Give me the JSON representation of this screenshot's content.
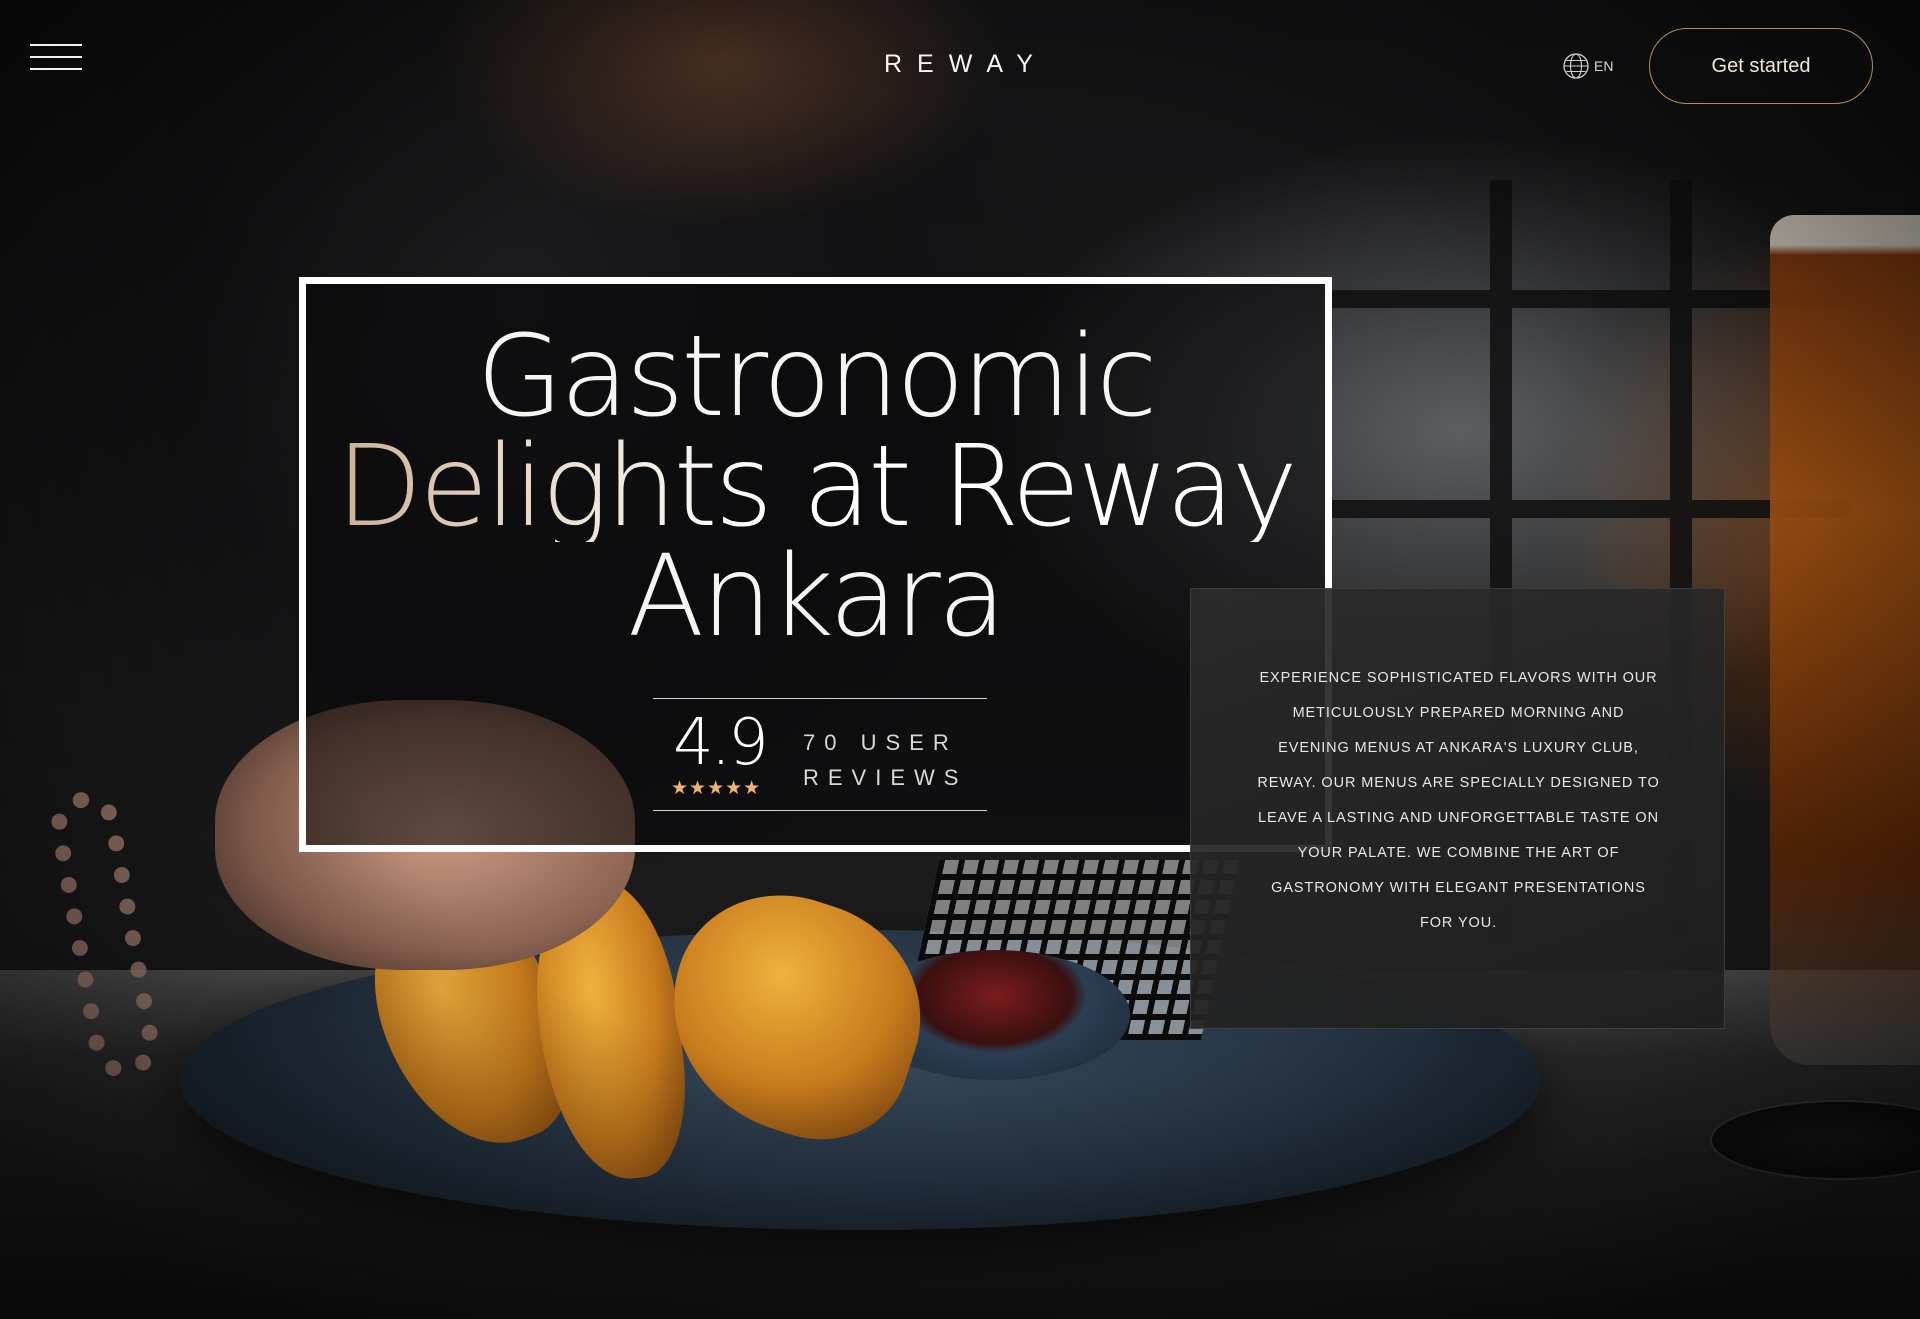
{
  "header": {
    "logo": "REWAY",
    "menu_icon": "hamburger-menu-icon",
    "language": "EN",
    "language_icon": "globe-icon",
    "cta_label": "Get started"
  },
  "hero": {
    "title_lines": [
      "Gastronomic",
      "Delights at Reway",
      "Ankara"
    ],
    "rating": {
      "score": "4.9",
      "stars": "★★★★★",
      "reviews_line1": "70 USER",
      "reviews_line2": "REVIEWS"
    },
    "description": "Experience sophisticated flavors with our meticulously prepared morning and evening menus at Ankara's luxury club, Reway. Our menus are specially designed to leave a lasting and unforgettable taste on your palate. We combine the art of gastronomy with elegant presentations for you."
  },
  "colors": {
    "accent_gold": "#b38b5d",
    "star": "#f2b36b",
    "card_border": "#ffffff"
  }
}
